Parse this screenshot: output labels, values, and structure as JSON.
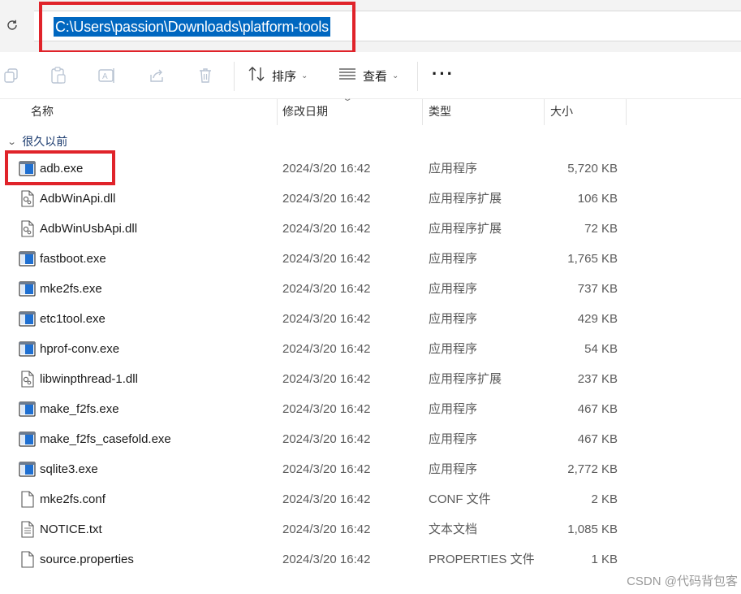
{
  "address_bar": {
    "path": "C:\\Users\\passion\\Downloads\\platform-tools",
    "refresh_icon": "refresh-icon"
  },
  "toolbar": {
    "icons": [
      "copy-icon",
      "paste-icon",
      "rename-icon",
      "share-icon",
      "delete-icon"
    ],
    "sort_label": "排序",
    "view_label": "查看",
    "more_label": "···"
  },
  "columns": {
    "name": "名称",
    "date": "修改日期",
    "type": "类型",
    "size": "大小"
  },
  "group_label": "很久以前",
  "files": [
    {
      "name": "adb.exe",
      "date": "2024/3/20 16:42",
      "type": "应用程序",
      "size": "5,720 KB",
      "icon": "exe-icon"
    },
    {
      "name": "AdbWinApi.dll",
      "date": "2024/3/20 16:42",
      "type": "应用程序扩展",
      "size": "106 KB",
      "icon": "dll-icon"
    },
    {
      "name": "AdbWinUsbApi.dll",
      "date": "2024/3/20 16:42",
      "type": "应用程序扩展",
      "size": "72 KB",
      "icon": "dll-icon"
    },
    {
      "name": "fastboot.exe",
      "date": "2024/3/20 16:42",
      "type": "应用程序",
      "size": "1,765 KB",
      "icon": "exe-icon"
    },
    {
      "name": "mke2fs.exe",
      "date": "2024/3/20 16:42",
      "type": "应用程序",
      "size": "737 KB",
      "icon": "exe-icon"
    },
    {
      "name": "etc1tool.exe",
      "date": "2024/3/20 16:42",
      "type": "应用程序",
      "size": "429 KB",
      "icon": "exe-icon"
    },
    {
      "name": "hprof-conv.exe",
      "date": "2024/3/20 16:42",
      "type": "应用程序",
      "size": "54 KB",
      "icon": "exe-icon"
    },
    {
      "name": "libwinpthread-1.dll",
      "date": "2024/3/20 16:42",
      "type": "应用程序扩展",
      "size": "237 KB",
      "icon": "dll-icon"
    },
    {
      "name": "make_f2fs.exe",
      "date": "2024/3/20 16:42",
      "type": "应用程序",
      "size": "467 KB",
      "icon": "exe-icon"
    },
    {
      "name": "make_f2fs_casefold.exe",
      "date": "2024/3/20 16:42",
      "type": "应用程序",
      "size": "467 KB",
      "icon": "exe-icon"
    },
    {
      "name": "sqlite3.exe",
      "date": "2024/3/20 16:42",
      "type": "应用程序",
      "size": "2,772 KB",
      "icon": "exe-icon"
    },
    {
      "name": "mke2fs.conf",
      "date": "2024/3/20 16:42",
      "type": "CONF 文件",
      "size": "2 KB",
      "icon": "file-icon"
    },
    {
      "name": "NOTICE.txt",
      "date": "2024/3/20 16:42",
      "type": "文本文档",
      "size": "1,085 KB",
      "icon": "text-file-icon"
    },
    {
      "name": "source.properties",
      "date": "2024/3/20 16:42",
      "type": "PROPERTIES 文件",
      "size": "1 KB",
      "icon": "file-icon"
    }
  ],
  "watermark": "CSDN @代码背包客",
  "colors": {
    "selection": "#0067c0",
    "highlight_box": "#e0232a",
    "exe_icon_blue": "#1f6fd0"
  }
}
